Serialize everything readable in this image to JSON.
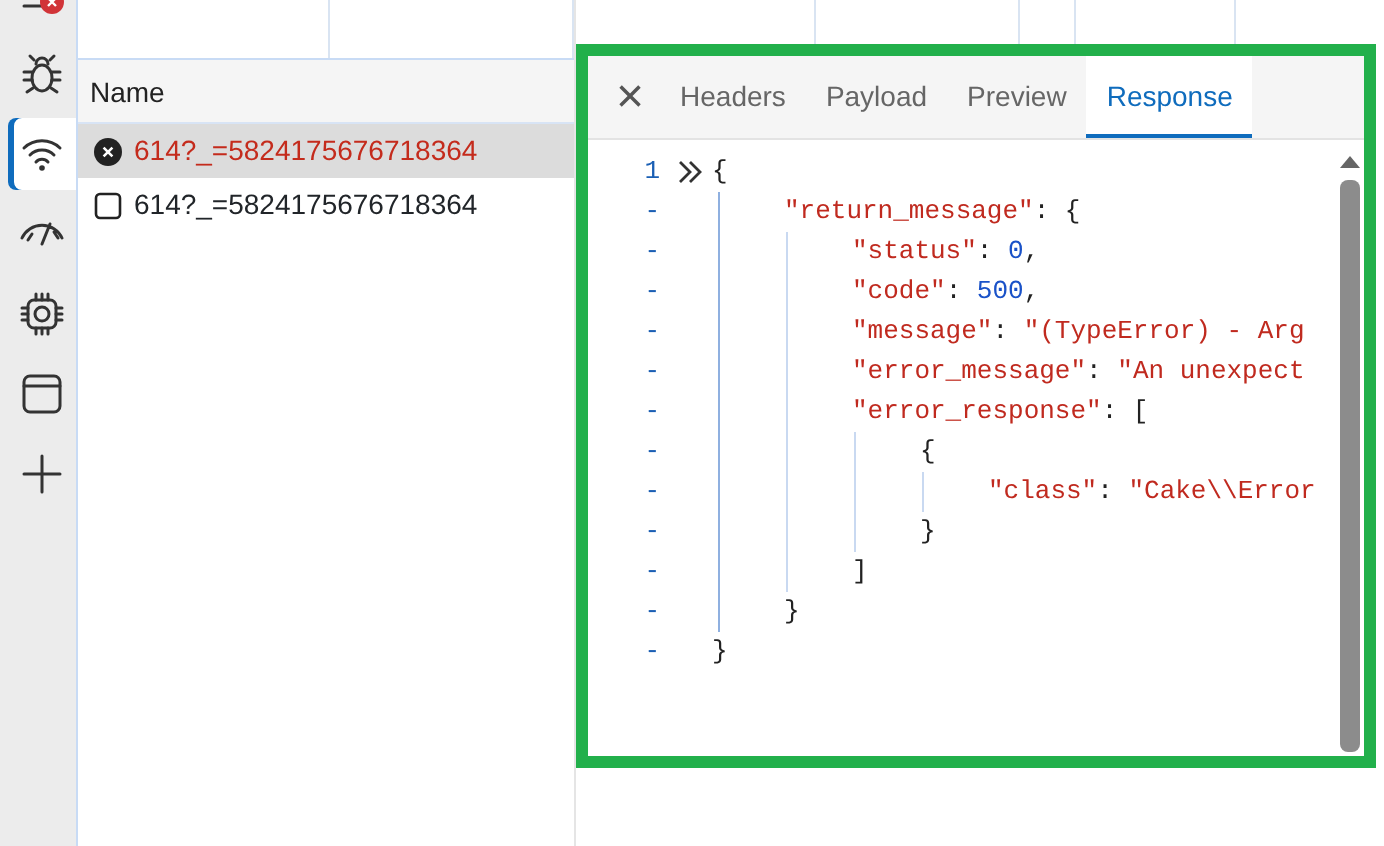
{
  "toolbar": [
    {
      "kind": "badge",
      "selected": false
    },
    {
      "kind": "bug",
      "selected": false
    },
    {
      "kind": "wifi",
      "selected": true
    },
    {
      "kind": "gauge",
      "selected": false
    },
    {
      "kind": "chip",
      "selected": false
    },
    {
      "kind": "window",
      "selected": false
    },
    {
      "kind": "plus",
      "selected": false
    }
  ],
  "requests": {
    "column": "Name",
    "rows": [
      {
        "name": "614?_=5824175676718364",
        "kind": "error",
        "selected": true
      },
      {
        "name": "614?_=5824175676718364",
        "kind": "document",
        "selected": false
      }
    ]
  },
  "details": {
    "close": "×",
    "tabs": [
      {
        "label": "Headers",
        "selected": false
      },
      {
        "label": "Payload",
        "selected": false
      },
      {
        "label": "Preview",
        "selected": false
      },
      {
        "label": "Response",
        "selected": true
      }
    ],
    "code": {
      "gutter": "1",
      "expand": true,
      "tokens": [
        {
          "kind": "punct",
          "text": "{"
        }
      ],
      "children": [
        {
          "gutter": "-",
          "tokens": [
            {
              "kind": "key",
              "text": "\"return_message\""
            },
            {
              "kind": "punct",
              "text": ": {"
            }
          ],
          "children": [
            {
              "gutter": "-",
              "tokens": [
                {
                  "kind": "key",
                  "text": "\"status\""
                },
                {
                  "kind": "punct",
                  "text": ": "
                },
                {
                  "kind": "number",
                  "text": "0"
                },
                {
                  "kind": "punct",
                  "text": ","
                }
              ]
            },
            {
              "gutter": "-",
              "tokens": [
                {
                  "kind": "key",
                  "text": "\"code\""
                },
                {
                  "kind": "punct",
                  "text": ": "
                },
                {
                  "kind": "number",
                  "text": "500"
                },
                {
                  "kind": "punct",
                  "text": ","
                }
              ]
            },
            {
              "gutter": "-",
              "tokens": [
                {
                  "kind": "key",
                  "text": "\"message\""
                },
                {
                  "kind": "punct",
                  "text": ": "
                },
                {
                  "kind": "string",
                  "text": "\"(TypeError) - Arg"
                }
              ]
            },
            {
              "gutter": "-",
              "tokens": [
                {
                  "kind": "key",
                  "text": "\"error_message\""
                },
                {
                  "kind": "punct",
                  "text": ": "
                },
                {
                  "kind": "string",
                  "text": "\"An unexpect"
                }
              ]
            },
            {
              "gutter": "-",
              "tokens": [
                {
                  "kind": "key",
                  "text": "\"error_response\""
                },
                {
                  "kind": "punct",
                  "text": ": ["
                }
              ],
              "children": [
                {
                  "gutter": "-",
                  "tokens": [
                    {
                      "kind": "punct",
                      "text": "{"
                    }
                  ],
                  "children": [
                    {
                      "gutter": "-",
                      "tokens": [
                        {
                          "kind": "key",
                          "text": "\"class\""
                        },
                        {
                          "kind": "punct",
                          "text": ": "
                        },
                        {
                          "kind": "string",
                          "text": "\"Cake\\\\Error"
                        }
                      ]
                    }
                  ],
                  "close": {
                    "gutter": "-",
                    "tokens": [
                      {
                        "kind": "punct",
                        "text": "}"
                      }
                    ]
                  }
                }
              ],
              "close": {
                "gutter": "-",
                "tokens": [
                  {
                    "kind": "punct",
                    "text": "]"
                  }
                ]
              }
            }
          ],
          "close": {
            "gutter": "-",
            "tokens": [
              {
                "kind": "punct",
                "text": "}"
              }
            ]
          }
        }
      ],
      "close": {
        "gutter": "-",
        "tokens": [
          {
            "kind": "punct",
            "text": "}"
          }
        ]
      }
    }
  }
}
